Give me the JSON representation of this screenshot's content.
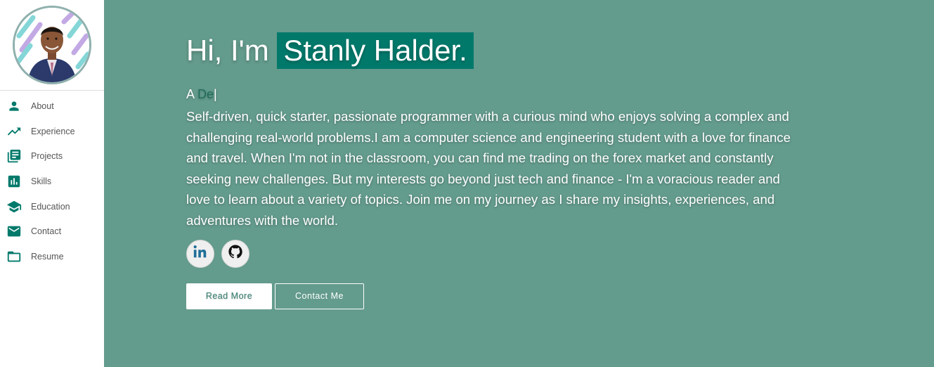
{
  "sidebar": {
    "avatar_alt": "Profile photo",
    "items": [
      {
        "label": "About",
        "icon": "person-icon"
      },
      {
        "label": "Experience",
        "icon": "trending-up-icon"
      },
      {
        "label": "Projects",
        "icon": "library-books-icon"
      },
      {
        "label": "Skills",
        "icon": "bar-chart-icon"
      },
      {
        "label": "Education",
        "icon": "school-icon"
      },
      {
        "label": "Contact",
        "icon": "mail-icon"
      },
      {
        "label": "Resume",
        "icon": "folder-icon"
      }
    ],
    "icon_color": "#00796b"
  },
  "hero": {
    "greeting_prefix": "Hi, I'm",
    "name": "Stanly Halder.",
    "typed_prefix": "A",
    "typed_text": "De",
    "cursor": "|",
    "bio": "Self-driven, quick starter, passionate programmer with a curious mind who enjoys solving a complex and challenging real-world problems.I am a computer science and engineering student with a love for finance and travel. When I'm not in the classroom, you can find me trading on the forex market and constantly seeking new challenges. But my interests go beyond just tech and finance - I'm a voracious reader and love to learn about a variety of topics. Join me on my journey as I share my insights, experiences, and adventures with the world."
  },
  "social": [
    {
      "name": "LinkedIn",
      "icon": "linkedin-icon"
    },
    {
      "name": "GitHub",
      "icon": "github-icon"
    }
  ],
  "buttons": {
    "read_more": "Read More",
    "contact_me": "Contact Me"
  },
  "colors": {
    "background": "#639b8c",
    "name_highlight": "#00796b",
    "accent": "#00796b"
  }
}
